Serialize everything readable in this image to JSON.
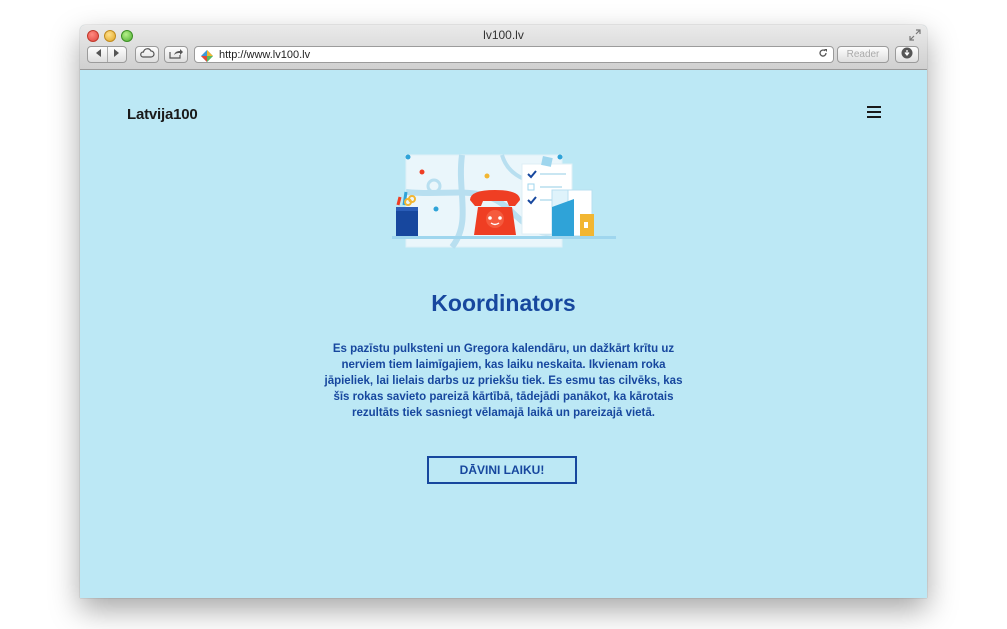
{
  "browser": {
    "window_title": "lv100.lv",
    "url": "http://www.lv100.lv",
    "reader_label": "Reader"
  },
  "icons": [
    "close-button",
    "minimize-button",
    "maximize-button",
    "back-arrow-icon",
    "forward-arrow-icon",
    "cloud-icon",
    "share-icon",
    "favicon",
    "reload-icon",
    "download-icon",
    "resize-icon",
    "hamburger-menu-icon"
  ],
  "site": {
    "logo": "Latvija100",
    "headline": "Koordinators",
    "paragraph": "Es pazīstu pulksteni un Gregora kalendāru, un dažkārt krītu uz nerviem tiem laimīgajiem, kas laiku neskaita. Ikvienam roka jāpieliek, lai lielais darbs uz priekšu tiek. Es esmu tas cilvēks, kas šīs rokas savieto pareizā kārtībā, tādejādi panākot, ka kārotais rezultāts tiek sasniegt vēlamajā laikā un pareizajā vietā.",
    "cta_label": "DĀVINI LAIKU!"
  },
  "colors": {
    "page_background": "#bce8f5",
    "accent_blue": "#17479e",
    "phone_red": "#ef3e23"
  }
}
